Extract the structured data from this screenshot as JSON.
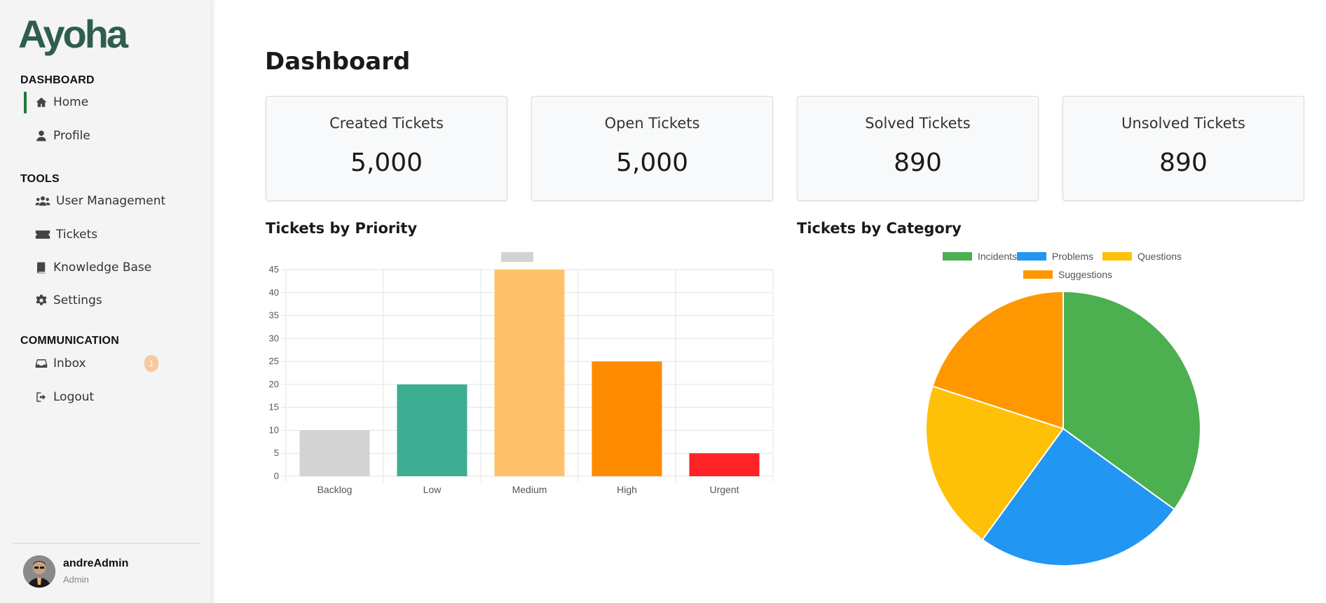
{
  "app": {
    "logo_text": "Ayoha"
  },
  "sidebar": {
    "sections": [
      {
        "title": "DASHBOARD",
        "items": [
          {
            "label": "Home",
            "icon": "home-icon",
            "active": true
          },
          {
            "label": "Profile",
            "icon": "user-icon"
          }
        ]
      },
      {
        "title": "TOOLS",
        "items": [
          {
            "label": "User Management",
            "icon": "users-icon"
          },
          {
            "label": "Tickets",
            "icon": "ticket-icon"
          },
          {
            "label": "Knowledge Base",
            "icon": "book-icon"
          },
          {
            "label": "Settings",
            "icon": "gear-icon"
          }
        ]
      },
      {
        "title": "COMMUNICATION",
        "items": [
          {
            "label": "Inbox",
            "icon": "inbox-icon",
            "badge": "1"
          },
          {
            "label": "Logout",
            "icon": "logout-icon"
          }
        ]
      }
    ],
    "user": {
      "name": "andreAdmin",
      "role": "Admin"
    }
  },
  "main": {
    "title": "Dashboard",
    "cards": [
      {
        "label": "Created Tickets",
        "value": "5,000"
      },
      {
        "label": "Open Tickets",
        "value": "5,000"
      },
      {
        "label": "Solved Tickets",
        "value": "890"
      },
      {
        "label": "Unsolved Tickets",
        "value": "890"
      }
    ],
    "charts": {
      "priority_title": "Tickets by Priority",
      "category_title": "Tickets by Category"
    }
  },
  "colors": {
    "accent": "#1e7a3a",
    "logo": "#2e5e4e"
  },
  "chart_data": [
    {
      "type": "bar",
      "title": "Tickets by Priority",
      "categories": [
        "Backlog",
        "Low",
        "Medium",
        "High",
        "Urgent"
      ],
      "values": [
        10,
        20,
        45,
        25,
        5
      ],
      "colors": [
        "#d3d3d3",
        "#3eae93",
        "#ffc16b",
        "#ff8c00",
        "#ff2227"
      ],
      "ylim": [
        0,
        45
      ],
      "yticks": [
        0,
        5,
        10,
        15,
        20,
        25,
        30,
        35,
        40,
        45
      ],
      "grid": true,
      "legend": "top"
    },
    {
      "type": "pie",
      "title": "Tickets by Category",
      "labels": [
        "Incidents",
        "Problems",
        "Questions",
        "Suggestions"
      ],
      "values": [
        35,
        25,
        20,
        20
      ],
      "colors": [
        "#4caf50",
        "#2196f3",
        "#ffc107",
        "#ff9800"
      ],
      "legend": "top"
    }
  ]
}
